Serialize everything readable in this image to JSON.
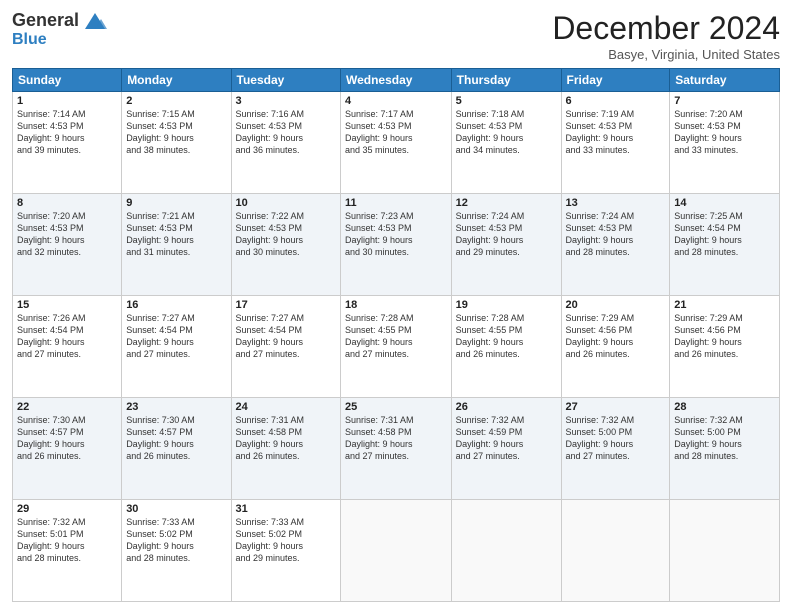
{
  "header": {
    "logo_general": "General",
    "logo_blue": "Blue",
    "month_title": "December 2024",
    "location": "Basye, Virginia, United States"
  },
  "columns": [
    "Sunday",
    "Monday",
    "Tuesday",
    "Wednesday",
    "Thursday",
    "Friday",
    "Saturday"
  ],
  "weeks": [
    [
      {
        "day": "1",
        "info": "Sunrise: 7:14 AM\nSunset: 4:53 PM\nDaylight: 9 hours\nand 39 minutes."
      },
      {
        "day": "2",
        "info": "Sunrise: 7:15 AM\nSunset: 4:53 PM\nDaylight: 9 hours\nand 38 minutes."
      },
      {
        "day": "3",
        "info": "Sunrise: 7:16 AM\nSunset: 4:53 PM\nDaylight: 9 hours\nand 36 minutes."
      },
      {
        "day": "4",
        "info": "Sunrise: 7:17 AM\nSunset: 4:53 PM\nDaylight: 9 hours\nand 35 minutes."
      },
      {
        "day": "5",
        "info": "Sunrise: 7:18 AM\nSunset: 4:53 PM\nDaylight: 9 hours\nand 34 minutes."
      },
      {
        "day": "6",
        "info": "Sunrise: 7:19 AM\nSunset: 4:53 PM\nDaylight: 9 hours\nand 33 minutes."
      },
      {
        "day": "7",
        "info": "Sunrise: 7:20 AM\nSunset: 4:53 PM\nDaylight: 9 hours\nand 33 minutes."
      }
    ],
    [
      {
        "day": "8",
        "info": "Sunrise: 7:20 AM\nSunset: 4:53 PM\nDaylight: 9 hours\nand 32 minutes."
      },
      {
        "day": "9",
        "info": "Sunrise: 7:21 AM\nSunset: 4:53 PM\nDaylight: 9 hours\nand 31 minutes."
      },
      {
        "day": "10",
        "info": "Sunrise: 7:22 AM\nSunset: 4:53 PM\nDaylight: 9 hours\nand 30 minutes."
      },
      {
        "day": "11",
        "info": "Sunrise: 7:23 AM\nSunset: 4:53 PM\nDaylight: 9 hours\nand 30 minutes."
      },
      {
        "day": "12",
        "info": "Sunrise: 7:24 AM\nSunset: 4:53 PM\nDaylight: 9 hours\nand 29 minutes."
      },
      {
        "day": "13",
        "info": "Sunrise: 7:24 AM\nSunset: 4:53 PM\nDaylight: 9 hours\nand 28 minutes."
      },
      {
        "day": "14",
        "info": "Sunrise: 7:25 AM\nSunset: 4:54 PM\nDaylight: 9 hours\nand 28 minutes."
      }
    ],
    [
      {
        "day": "15",
        "info": "Sunrise: 7:26 AM\nSunset: 4:54 PM\nDaylight: 9 hours\nand 27 minutes."
      },
      {
        "day": "16",
        "info": "Sunrise: 7:27 AM\nSunset: 4:54 PM\nDaylight: 9 hours\nand 27 minutes."
      },
      {
        "day": "17",
        "info": "Sunrise: 7:27 AM\nSunset: 4:54 PM\nDaylight: 9 hours\nand 27 minutes."
      },
      {
        "day": "18",
        "info": "Sunrise: 7:28 AM\nSunset: 4:55 PM\nDaylight: 9 hours\nand 27 minutes."
      },
      {
        "day": "19",
        "info": "Sunrise: 7:28 AM\nSunset: 4:55 PM\nDaylight: 9 hours\nand 26 minutes."
      },
      {
        "day": "20",
        "info": "Sunrise: 7:29 AM\nSunset: 4:56 PM\nDaylight: 9 hours\nand 26 minutes."
      },
      {
        "day": "21",
        "info": "Sunrise: 7:29 AM\nSunset: 4:56 PM\nDaylight: 9 hours\nand 26 minutes."
      }
    ],
    [
      {
        "day": "22",
        "info": "Sunrise: 7:30 AM\nSunset: 4:57 PM\nDaylight: 9 hours\nand 26 minutes."
      },
      {
        "day": "23",
        "info": "Sunrise: 7:30 AM\nSunset: 4:57 PM\nDaylight: 9 hours\nand 26 minutes."
      },
      {
        "day": "24",
        "info": "Sunrise: 7:31 AM\nSunset: 4:58 PM\nDaylight: 9 hours\nand 26 minutes."
      },
      {
        "day": "25",
        "info": "Sunrise: 7:31 AM\nSunset: 4:58 PM\nDaylight: 9 hours\nand 27 minutes."
      },
      {
        "day": "26",
        "info": "Sunrise: 7:32 AM\nSunset: 4:59 PM\nDaylight: 9 hours\nand 27 minutes."
      },
      {
        "day": "27",
        "info": "Sunrise: 7:32 AM\nSunset: 5:00 PM\nDaylight: 9 hours\nand 27 minutes."
      },
      {
        "day": "28",
        "info": "Sunrise: 7:32 AM\nSunset: 5:00 PM\nDaylight: 9 hours\nand 28 minutes."
      }
    ],
    [
      {
        "day": "29",
        "info": "Sunrise: 7:32 AM\nSunset: 5:01 PM\nDaylight: 9 hours\nand 28 minutes."
      },
      {
        "day": "30",
        "info": "Sunrise: 7:33 AM\nSunset: 5:02 PM\nDaylight: 9 hours\nand 28 minutes."
      },
      {
        "day": "31",
        "info": "Sunrise: 7:33 AM\nSunset: 5:02 PM\nDaylight: 9 hours\nand 29 minutes."
      },
      {
        "day": "",
        "info": ""
      },
      {
        "day": "",
        "info": ""
      },
      {
        "day": "",
        "info": ""
      },
      {
        "day": "",
        "info": ""
      }
    ]
  ]
}
